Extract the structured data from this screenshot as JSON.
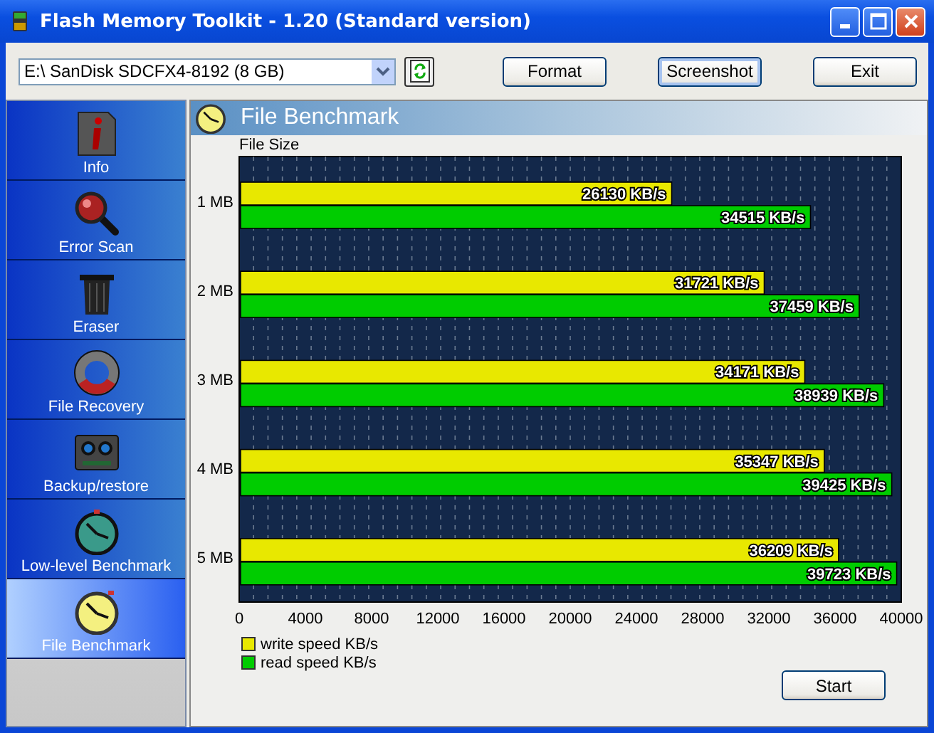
{
  "window": {
    "title": "Flash Memory Toolkit - 1.20 (Standard version)"
  },
  "toolbar": {
    "drive": {
      "value": "E:\\ SanDisk SDCFX4-8192 (8 GB)"
    },
    "buttons": [
      {
        "label": "Format",
        "selected": false
      },
      {
        "label": "Screenshot",
        "selected": true
      },
      {
        "label": "Exit",
        "selected": false
      }
    ]
  },
  "sidebar": {
    "items": [
      {
        "label": "Info",
        "kind": "info",
        "selected": false
      },
      {
        "label": "Error Scan",
        "kind": "scan",
        "selected": false
      },
      {
        "label": "Eraser",
        "kind": "eraser",
        "selected": false
      },
      {
        "label": "File Recovery",
        "kind": "recovery",
        "selected": false
      },
      {
        "label": "Backup/restore",
        "kind": "backup",
        "selected": false
      },
      {
        "label": "Low-level Benchmark",
        "kind": "lowbench",
        "selected": false
      },
      {
        "label": "File Benchmark",
        "kind": "filebench",
        "selected": true
      }
    ]
  },
  "panel": {
    "title": "File Benchmark",
    "start_button": "Start",
    "chart_data": {
      "type": "bar",
      "orientation": "horizontal",
      "ylabel": "File Size",
      "categories": [
        "1 MB",
        "2 MB",
        "3 MB",
        "4 MB",
        "5 MB"
      ],
      "series": [
        {
          "name": "write speed KB/s",
          "color": "#e8e800",
          "values": [
            26130,
            31721,
            34171,
            35347,
            36209
          ],
          "value_labels": [
            "26130 KB/s",
            "31721 KB/s",
            "34171 KB/s",
            "35347 KB/s",
            "36209 KB/s"
          ]
        },
        {
          "name": "read speed KB/s",
          "color": "#00cc00",
          "values": [
            34515,
            37459,
            38939,
            39425,
            39723
          ],
          "value_labels": [
            "34515 KB/s",
            "37459 KB/s",
            "38939 KB/s",
            "39425 KB/s",
            "39723 KB/s"
          ]
        }
      ],
      "legend": true,
      "xlim": [
        0,
        40000
      ],
      "xticks": [
        0,
        4000,
        8000,
        12000,
        16000,
        20000,
        24000,
        28000,
        32000,
        36000,
        40000
      ]
    }
  }
}
